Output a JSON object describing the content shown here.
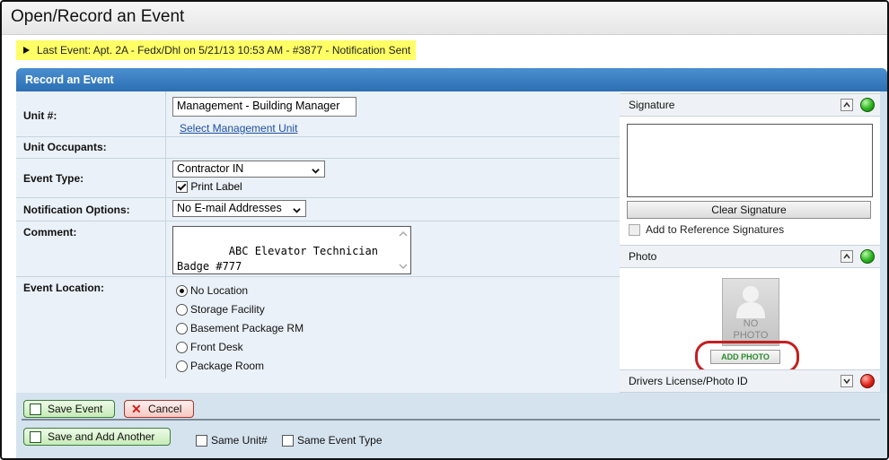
{
  "page": {
    "title": "Open/Record an Event"
  },
  "last_event": {
    "text": "Last Event: Apt. 2A - Fedx/Dhl on 5/21/13 10:53 AM - #3877 - Notification Sent"
  },
  "panel": {
    "header": "Record an Event"
  },
  "form": {
    "unit": {
      "label": "Unit #:",
      "value": "Management - Building Manager",
      "link": "Select Management Unit"
    },
    "occupants": {
      "label": "Unit Occupants:"
    },
    "event_type": {
      "label": "Event Type:",
      "selected": "Contractor IN",
      "print_label": "Print Label",
      "print_checked": true
    },
    "notification": {
      "label": "Notification Options:",
      "selected": "No E-mail Addresses"
    },
    "comment": {
      "label": "Comment:",
      "value": "ABC Elevator Technician\nBadge #777"
    },
    "location": {
      "label": "Event Location:",
      "options": [
        "No Location",
        "Storage Facility",
        "Basement Package RM",
        "Front Desk",
        "Package Room"
      ],
      "selected": "No Location"
    }
  },
  "signature": {
    "title": "Signature",
    "clear_label": "Clear Signature",
    "ref_label": "Add to Reference Signatures",
    "status": "green"
  },
  "photo": {
    "title": "Photo",
    "placeholder_line1": "NO",
    "placeholder_line2": "PHOTO",
    "add_label": "ADD PHOTO",
    "status": "green"
  },
  "license": {
    "title": "Drivers License/Photo ID",
    "status": "red"
  },
  "actions": {
    "save": "Save Event",
    "cancel": "Cancel",
    "save_add": "Save and Add Another",
    "same_unit": "Same Unit#",
    "same_event_type": "Same Event Type"
  },
  "colors": {
    "header_blue": "#2c6fb4",
    "highlight_yellow": "#ffff66",
    "ring_red": "#c32020"
  },
  "icons": [
    "disclosure-triangle-icon",
    "chevron-down-icon",
    "chevron-up-icon",
    "floppy-disk-icon",
    "x-icon",
    "status-led-icon"
  ]
}
